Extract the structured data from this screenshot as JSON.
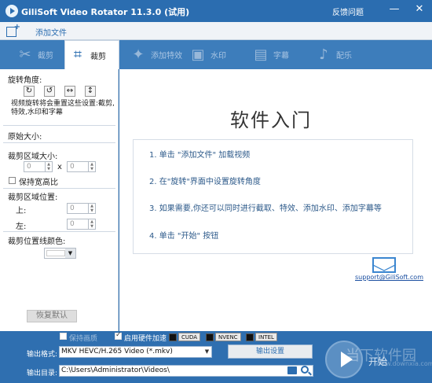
{
  "window": {
    "title": "GiliSoft Video Rotator 11.3.0 (试用)",
    "feedback": "反馈问题",
    "minimize": "—",
    "close": "✕"
  },
  "toolbar": {
    "add_file": "添加文件"
  },
  "tabs": [
    {
      "label": "截剪",
      "icon": "scissors-icon",
      "active": false
    },
    {
      "label": "裁剪",
      "icon": "crop-icon",
      "active": true
    },
    {
      "label": "添加特效",
      "icon": "effects-wand-icon",
      "active": false
    },
    {
      "label": "水印",
      "icon": "watermark-icon",
      "active": false
    },
    {
      "label": "字幕",
      "icon": "subtitle-film-icon",
      "active": false
    },
    {
      "label": "配乐",
      "icon": "music-note-icon",
      "active": false
    }
  ],
  "left_panel": {
    "rotate_label": "旋转角度:",
    "rotate_buttons": [
      "rotate-clockwise",
      "rotate-counterclockwise",
      "flip-horizontal",
      "flip-vertical"
    ],
    "rotate_note": "视频旋转将会重置这些设置:截剪, 特效,水印和字幕",
    "original_size": "原始大小:",
    "crop_size": "裁剪区域大小:",
    "width_value": "0",
    "height_value": "0",
    "times": "x",
    "keep_ratio": "保持宽高比",
    "crop_pos": "裁剪区域位置:",
    "top_label": "上:",
    "top_value": "0",
    "left_label": "左:",
    "left_value": "0",
    "line_color": "裁剪位置线颜色:",
    "reset": "恢复默认"
  },
  "main": {
    "title": "软件入门",
    "steps": [
      "1. 单击 \"添加文件\" 加载视频",
      "2. 在\"旋转\"界面中设置旋转角度",
      "3. 如果需要,你还可以同时进行截取、特效、添加水印、添加字幕等",
      "4. 单击 \"开始\" 按钮"
    ],
    "support_email": "support@GiliSoft.com"
  },
  "bottom": {
    "lossless": "保持画质",
    "hw_accel": "启用硬件加速",
    "hw_options": [
      "CUDA",
      "NVENC",
      "INTEL"
    ],
    "format_label": "输出格式:",
    "format_value": "MKV HEVC/H.265 Video (*.mkv)",
    "settings_button": "输出设置",
    "dir_label": "输出目录:",
    "dir_value": "C:\\Users\\Administrator\\Videos\\",
    "start": "开始",
    "watermark": "当下软件园",
    "watermark_sub": "www.downxia.com"
  }
}
